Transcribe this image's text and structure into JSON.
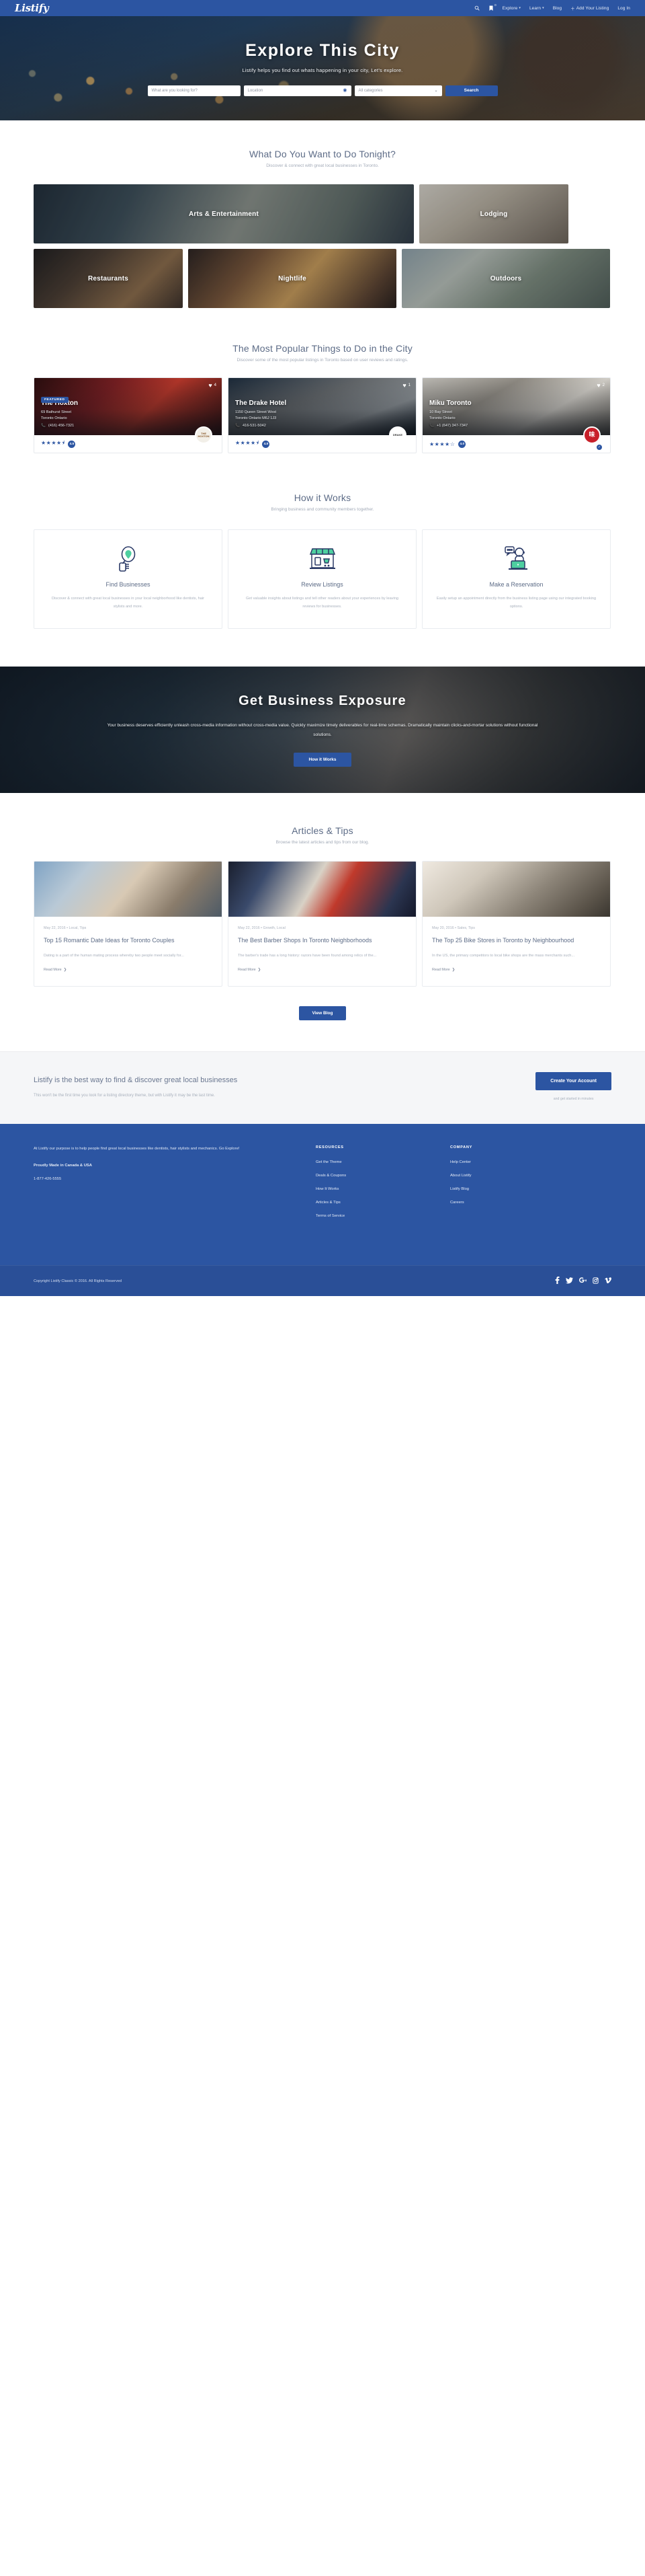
{
  "brand": {
    "name": "Listify",
    "accent": "#2c55a2"
  },
  "header": {
    "nav": [
      {
        "label": "Explore",
        "icon": "chevron-down-icon"
      },
      {
        "label": "Learn",
        "icon": "chevron-down-icon"
      },
      {
        "label": "Blog",
        "icon": ""
      },
      {
        "label": "Add Your Listing",
        "icon": "plus-icon"
      },
      {
        "label": "Log In",
        "icon": ""
      }
    ],
    "search_icon": "search-icon",
    "bookmark_icon": "bookmark-icon",
    "bookmark_count": "0"
  },
  "hero": {
    "title": "Explore This City",
    "subtitle": "Listify helps you find out whats happening in your city, Let's explore.",
    "keyword_placeholder": "What are you looking for?",
    "location_placeholder": "Location",
    "category_selected": "All categories",
    "search_button": "Search"
  },
  "categories_section": {
    "title": "What Do You Want to Do Tonight?",
    "subtitle": "Discover & connect with great local businesses in Toronto.",
    "tiles": [
      {
        "label": "Arts & Entertainment"
      },
      {
        "label": "Lodging"
      },
      {
        "label": "Restaurants"
      },
      {
        "label": "Nightlife"
      },
      {
        "label": "Outdoors"
      }
    ]
  },
  "popular_section": {
    "title": "The Most Popular Things to Do in the City",
    "subtitle": "Discover some of the most popular listings in Toronto based on user reviews and ratings.",
    "listings": [
      {
        "name": "The Hoxton",
        "featured_tag": "FEATURED",
        "address1": "69 Bathurst Street",
        "address2": "Toronto Ontario",
        "phone": "(416) 456-7321",
        "favorites": "4",
        "stars": "★★★★⯨",
        "rating": "4.5",
        "brand_mark": "THE HOXTON"
      },
      {
        "name": "The Drake Hotel",
        "featured_tag": "",
        "address1": "1150 Queen Street West",
        "address2": "Toronto Ontario M6J 1J3",
        "phone": "416-531-5042",
        "favorites": "1",
        "stars": "★★★★⯨",
        "rating": "4.5",
        "brand_mark": "DRAKE"
      },
      {
        "name": "Miku Toronto",
        "featured_tag": "",
        "address1": "10 Bay Street",
        "address2": "Toronto Ontario",
        "phone": "+1 (647) 347-7347",
        "favorites": "2",
        "stars": "★★★★☆",
        "rating": "4.0",
        "brand_mark": "味"
      }
    ]
  },
  "how_section": {
    "title": "How it Works",
    "subtitle": "Bringing business and community members together.",
    "cards": [
      {
        "icon": "magnifier-pin-icon",
        "title": "Find Businesses",
        "text": "Discover & connect with great local businesses in your local neighborhood like dentists, hair stylists and more."
      },
      {
        "icon": "storefront-icon",
        "title": "Review Listings",
        "text": "Get valuable insights about listings and tell other readers about your experiences by leaving reviews for businesses."
      },
      {
        "icon": "support-agent-icon",
        "title": "Make a Reservation",
        "text": "Easily setup an appointment directly from the business listing page using our integrated booking options."
      }
    ]
  },
  "exposure": {
    "title": "Get Business Exposure",
    "text": "Your business deserves efficiently unleash cross-media information without cross-media value. Quickly maximize timely deliverables for real-time schemas. Dramatically maintain clicks-and-mortar solutions without functional solutions.",
    "button": "How it Works"
  },
  "articles_section": {
    "title": "Articles & Tips",
    "subtitle": "Browse the latest articles and tips from our blog.",
    "view_blog_button": "View Blog",
    "read_more": "Read More",
    "posts": [
      {
        "meta": "May 22, 2016 • Local, Tips",
        "title": "Top 15 Romantic Date Ideas for Toronto Couples",
        "excerpt": "Dating is a part of the human mating process whereby two people meet socially for..."
      },
      {
        "meta": "May 22, 2016 • Growth, Local",
        "title": "The Best Barber Shops In Toronto Neighborhoods",
        "excerpt": "The barber's trade has a long history: razors have been found among relics of the..."
      },
      {
        "meta": "May 20, 2016 • Sales, Tips",
        "title": "The Top 25 Bike Stores in Toronto by Neighbourhood",
        "excerpt": "In the US, the primary competitors to local bike shops are the mass merchants such..."
      }
    ]
  },
  "cta": {
    "title": "Listify is the best way to find & discover great local businesses",
    "subtitle": "This won't be the first time you look for a listing directory theme, but with Listify it may be the last time.",
    "button": "Create Your Account",
    "note": "and get started in minutes"
  },
  "footer": {
    "about": "At Listify our purpose is to help people find great local businesses like dentists, hair stylists and mechanics. Go Explore!",
    "made": "Proudly Made in Canada & USA",
    "phone": "1-877-426-5555",
    "columns": [
      {
        "heading": "RESOURCES",
        "links": [
          "Get the Theme",
          "Deals & Coupons",
          "How It Works",
          "Articles & Tips",
          "Terms of Service"
        ]
      },
      {
        "heading": "COMPANY",
        "links": [
          "Help Center",
          "About Listify",
          "Listify Blog",
          "Careers"
        ]
      }
    ],
    "copyright": "Copyright Listify Classic © 2016. All Rights Reserved",
    "socials": [
      "facebook-icon",
      "twitter-icon",
      "google-plus-icon",
      "instagram-icon",
      "vimeo-icon"
    ]
  }
}
